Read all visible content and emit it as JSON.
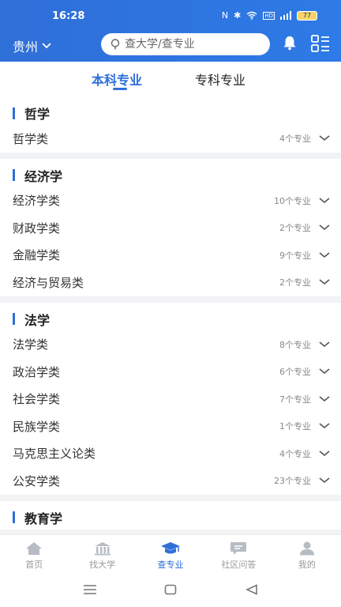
{
  "status": {
    "time": "16:28",
    "battery": "77"
  },
  "header": {
    "city": "贵州",
    "search_placeholder": "查大学/查专业"
  },
  "tabs": [
    {
      "label": "本科专业",
      "active": true
    },
    {
      "label": "专科专业",
      "active": false
    }
  ],
  "sections": [
    {
      "title": "哲学",
      "items": [
        {
          "label": "哲学类",
          "count": "4个专业"
        }
      ]
    },
    {
      "title": "经济学",
      "items": [
        {
          "label": "经济学类",
          "count": "10个专业"
        },
        {
          "label": "财政学类",
          "count": "2个专业"
        },
        {
          "label": "金融学类",
          "count": "9个专业"
        },
        {
          "label": "经济与贸易类",
          "count": "2个专业"
        }
      ]
    },
    {
      "title": "法学",
      "items": [
        {
          "label": "法学类",
          "count": "8个专业"
        },
        {
          "label": "政治学类",
          "count": "6个专业"
        },
        {
          "label": "社会学类",
          "count": "7个专业"
        },
        {
          "label": "民族学类",
          "count": "1个专业"
        },
        {
          "label": "马克思主义论类",
          "count": "4个专业"
        },
        {
          "label": "公安学类",
          "count": "23个专业"
        }
      ]
    },
    {
      "title": "教育学",
      "items": []
    }
  ],
  "tabbar": [
    {
      "label": "首页",
      "icon": "home-icon",
      "active": false
    },
    {
      "label": "找大学",
      "icon": "university-icon",
      "active": false
    },
    {
      "label": "查专业",
      "icon": "graduation-cap-icon",
      "active": true
    },
    {
      "label": "社区问答",
      "icon": "chat-icon",
      "active": false
    },
    {
      "label": "我的",
      "icon": "user-icon",
      "active": false
    }
  ],
  "colors": {
    "accent": "#2f6fd8",
    "background": "#f2f3f5"
  }
}
